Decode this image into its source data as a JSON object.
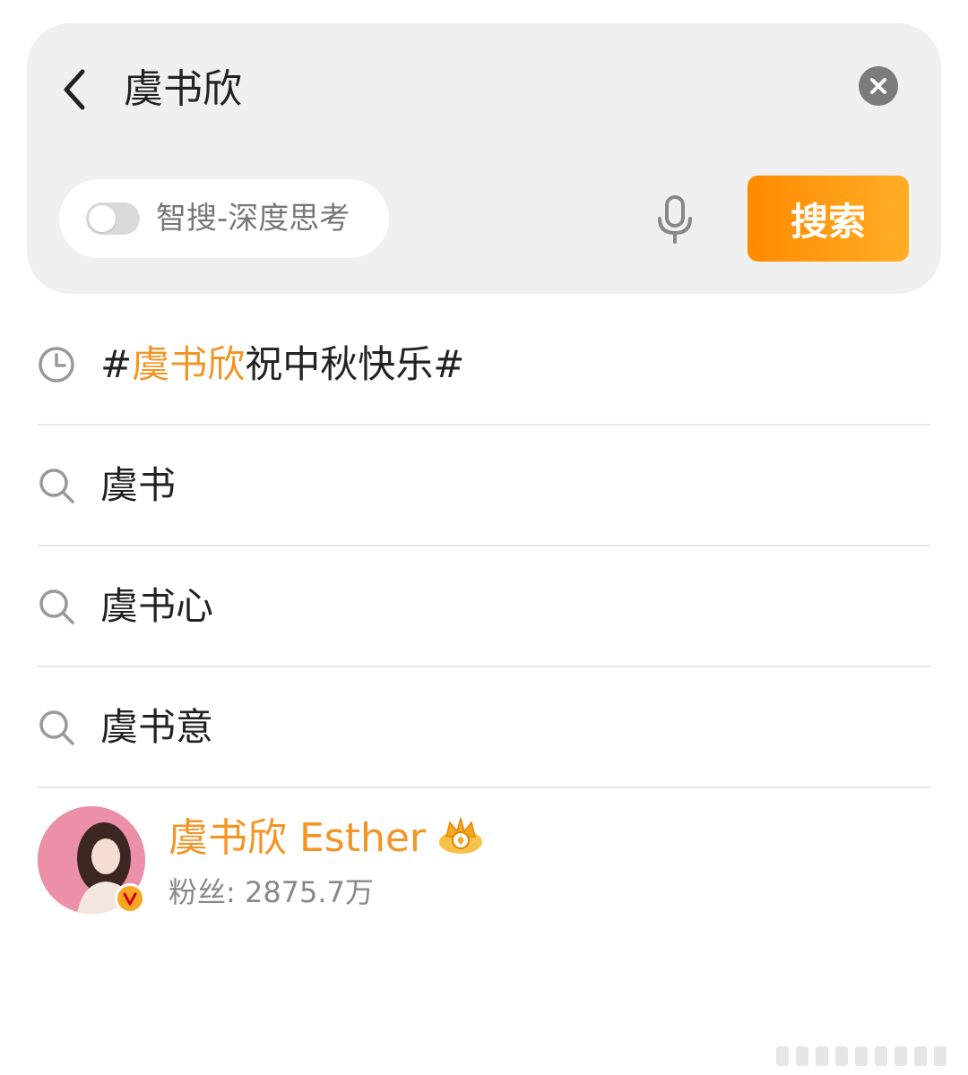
{
  "search": {
    "query": "虞书欣",
    "toggle_label": "智搜-深度思考",
    "toggle_on": false,
    "submit_label": "搜索",
    "accent_color": "#ff9500"
  },
  "suggestions": [
    {
      "type": "history",
      "icon": "clock-icon",
      "prefix": "#",
      "highlight": "虞书欣",
      "rest": "祝中秋快乐#"
    },
    {
      "type": "suggest",
      "icon": "search-icon",
      "prefix": "",
      "highlight": "",
      "rest": "虞书"
    },
    {
      "type": "suggest",
      "icon": "search-icon",
      "prefix": "",
      "highlight": "",
      "rest": "虞书心"
    },
    {
      "type": "suggest",
      "icon": "search-icon",
      "prefix": "",
      "highlight": "",
      "rest": "虞书意"
    }
  ],
  "account": {
    "name": "虞书欣 Esther",
    "fans": "粉丝: 2875.7万",
    "verified": true,
    "badge_icon": "crown-badge-icon",
    "name_color": "#f39524"
  }
}
